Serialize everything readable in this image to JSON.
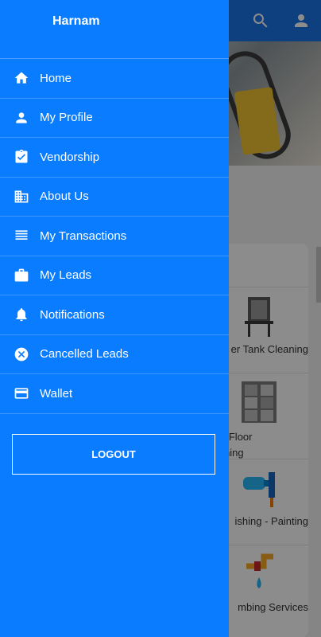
{
  "drawer": {
    "title": "Harnam",
    "items": [
      {
        "label": "Home",
        "icon": "home-icon"
      },
      {
        "label": "My Profile",
        "icon": "person-icon"
      },
      {
        "label": "Vendorship",
        "icon": "clipboard-check-icon"
      },
      {
        "label": "About Us",
        "icon": "building-icon"
      },
      {
        "label": "My Transactions",
        "icon": "list-icon"
      },
      {
        "label": "My Leads",
        "icon": "briefcase-icon"
      },
      {
        "label": "Notifications",
        "icon": "bell-icon"
      },
      {
        "label": "Cancelled Leads",
        "icon": "cancel-circle-icon"
      },
      {
        "label": "Wallet",
        "icon": "card-icon"
      }
    ],
    "logout_label": "LOGOUT",
    "accent": "#0a7cff"
  },
  "background": {
    "topbar_icons": [
      "search-icon",
      "account-icon"
    ],
    "services": [
      {
        "label": "er Tank Cleaning"
      },
      {
        "label": "Marble Floor\nCleaning"
      },
      {
        "label": "ishing - Painting"
      },
      {
        "label": "mbing Services"
      }
    ]
  }
}
